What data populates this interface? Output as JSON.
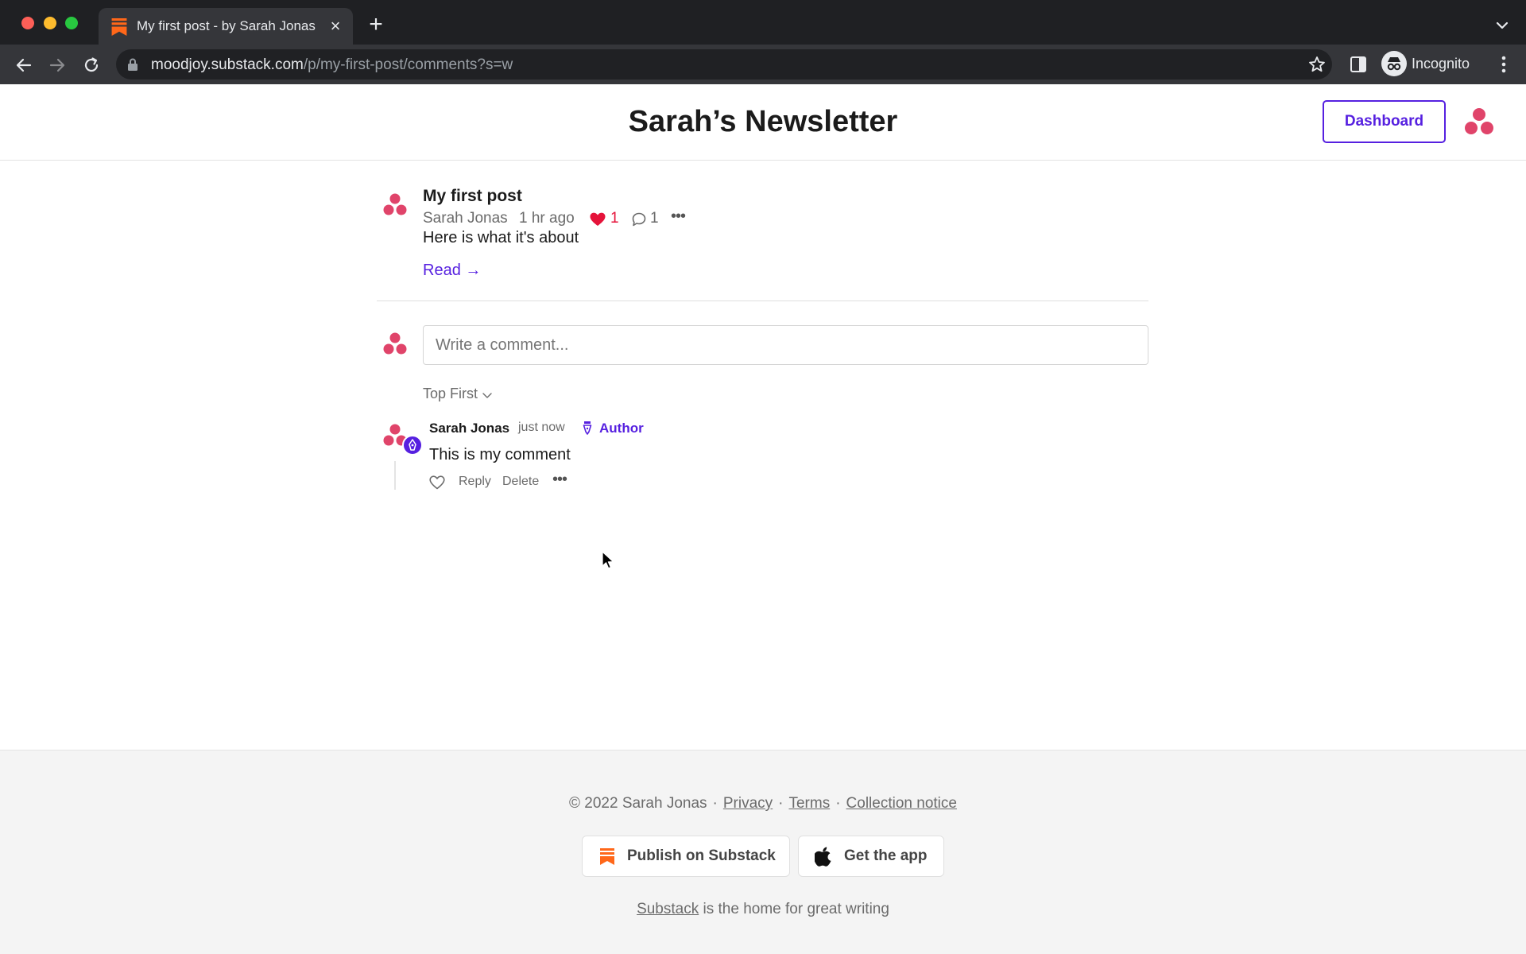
{
  "browser": {
    "tab_title": "My first post - by Sarah Jonas",
    "url_host": "moodjoy.substack.com",
    "url_path": "/p/my-first-post/comments?s=w",
    "incognito_label": "Incognito",
    "icons": [
      "back-icon",
      "forward-icon",
      "reload-icon",
      "lock-icon",
      "star-icon",
      "side-panel-icon",
      "incognito-icon",
      "kebab-menu-icon"
    ]
  },
  "header": {
    "title": "Sarah’s Newsletter",
    "dashboard_label": "Dashboard"
  },
  "post": {
    "title": "My first post",
    "author": "Sarah Jonas",
    "time": "1 hr ago",
    "likes": "1",
    "comments": "1",
    "subtitle": "Here is what it's about",
    "read_label": "Read →"
  },
  "composer": {
    "placeholder": "Write a comment..."
  },
  "sort": {
    "label": "Top First"
  },
  "comment": {
    "author": "Sarah Jonas",
    "time": "just now",
    "role": "Author",
    "body": "This is my comment",
    "reply_label": "Reply",
    "delete_label": "Delete"
  },
  "footer": {
    "copyright": "© 2022 Sarah Jonas",
    "privacy": "Privacy",
    "terms": "Terms",
    "collection": "Collection notice",
    "publish_label": "Publish on Substack",
    "app_label": "Get the app",
    "substack_link": "Substack",
    "tagline_rest": " is the home for great writing"
  },
  "colors": {
    "accent": "#5620e0",
    "like": "#e5133a",
    "brand_orange": "#ff6719",
    "avatar_pink": "#e0446a"
  }
}
